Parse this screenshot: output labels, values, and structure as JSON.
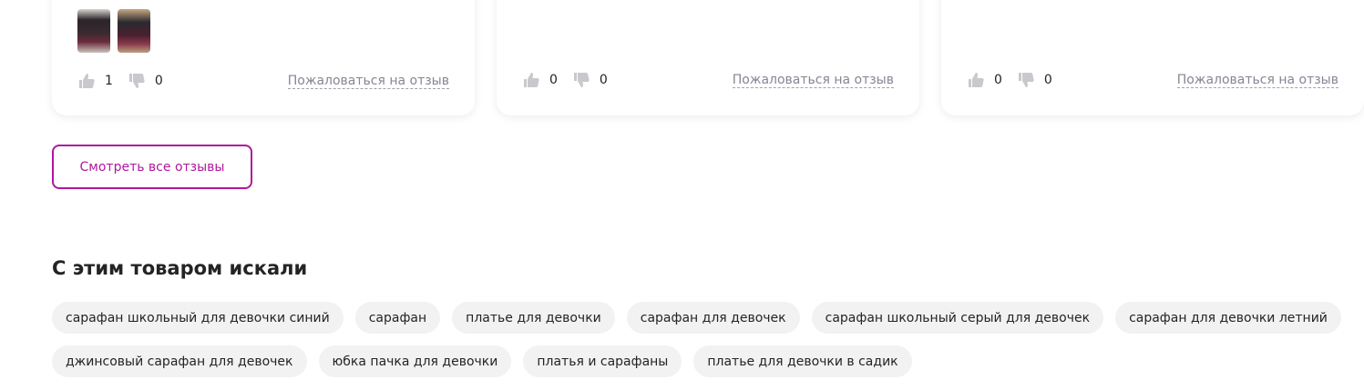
{
  "reviews": [
    {
      "likes": "1",
      "dislikes": "0",
      "complain_label": "Пожаловаться на отзыв"
    },
    {
      "likes": "0",
      "dislikes": "0",
      "complain_label": "Пожаловаться на отзыв"
    },
    {
      "likes": "0",
      "dislikes": "0",
      "complain_label": "Пожаловаться на отзыв"
    }
  ],
  "all_reviews_button": "Смотреть все отзывы",
  "searched_section": {
    "title": "С этим товаром искали",
    "chips": [
      "сарафан школьный для девочки синий",
      "сарафан",
      "платье для девочки",
      "сарафан для девочек",
      "сарафан школьный серый для девочек",
      "сарафан для девочки летний",
      "джинсовый сарафан для девочек",
      "юбка пачка для девочки",
      "платья и сарафаны",
      "платье для девочки в садик"
    ]
  },
  "icons": {
    "like": "thumbs-up-icon",
    "dislike": "thumbs-down-icon"
  },
  "colors": {
    "accent": "#b0179e",
    "chip_bg": "#f2f2f3",
    "muted": "#868695"
  }
}
